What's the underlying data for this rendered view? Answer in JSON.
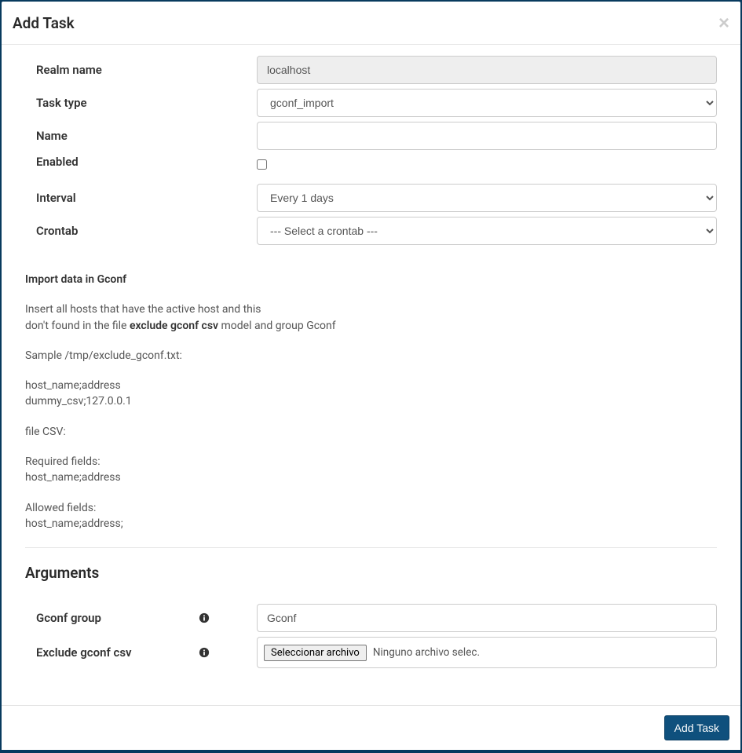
{
  "header": {
    "title": "Add Task",
    "close": "×"
  },
  "labels": {
    "realm_name": "Realm name",
    "task_type": "Task type",
    "name": "Name",
    "enabled": "Enabled",
    "interval": "Interval",
    "crontab": "Crontab",
    "arguments": "Arguments",
    "gconf_group": "Gconf group",
    "exclude_csv": "Exclude gconf csv"
  },
  "values": {
    "realm_name": "localhost",
    "task_type": "gconf_import",
    "name": "",
    "interval": "Every 1 days",
    "crontab": "--- Select a crontab ---",
    "gconf_group": "Gconf"
  },
  "description": {
    "title": "Import data in Gconf",
    "line1": "Insert all hosts that have the active host and this",
    "line2a": "don't found in the file ",
    "strong": "exclude gconf csv",
    "line2b": "  model and group Gconf",
    "sample_label": "Sample /tmp/exclude_gconf.txt:",
    "sample_header": "host_name;address",
    "sample_row": "dummy_csv;127.0.0.1",
    "file_csv": "file CSV:",
    "required_label": "Required fields:",
    "required_fields": "host_name;address",
    "allowed_label": "Allowed fields:",
    "allowed_fields": "host_name;address;"
  },
  "file": {
    "button": "Seleccionar archivo",
    "status": "Ninguno archivo selec."
  },
  "footer": {
    "submit": "Add Task"
  }
}
